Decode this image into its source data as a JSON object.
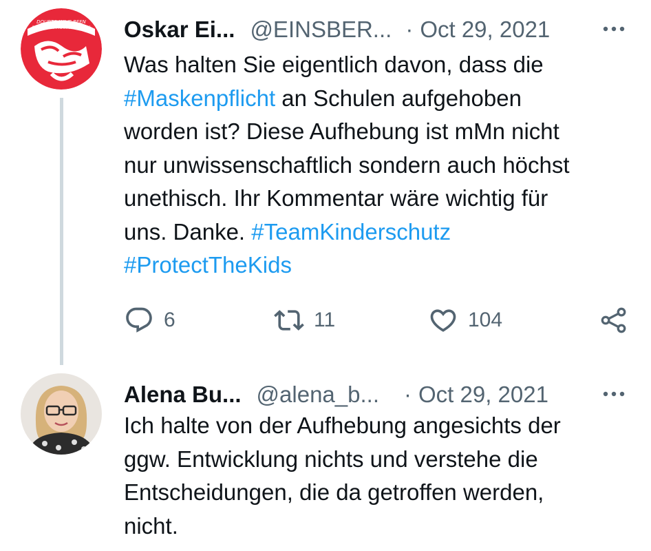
{
  "tweets": [
    {
      "name": "Oskar Ei...",
      "handle": "@EINSBER...",
      "separator": "·",
      "date": "Oct 29, 2021",
      "avatar_text": "DOUBTS HAVE BEEN PLACED BY MOVING IMAGES",
      "text_segments": [
        {
          "text": "Was halten Sie eigentlich davon, dass die",
          "type": "text",
          "break": true
        },
        {
          "text": "#Maskenpflicht",
          "type": "hashtag"
        },
        {
          "text": " an Schulen aufgehoben",
          "type": "text",
          "break": true
        },
        {
          "text": "worden ist? Diese Aufhebung ist mMn nicht",
          "type": "text",
          "break": true
        },
        {
          "text": "nur unwissenschaftlich sondern auch höchst",
          "type": "text",
          "break": true
        },
        {
          "text": "unethisch. Ihr Kommentar wäre wichtig für",
          "type": "text",
          "break": true
        },
        {
          "text": "uns. Danke. ",
          "type": "text"
        },
        {
          "text": "#TeamKinderschutz",
          "type": "hashtag",
          "break": true
        },
        {
          "text": "#ProtectTheKids",
          "type": "hashtag"
        }
      ],
      "replies": "6",
      "retweets": "11",
      "likes": "104"
    },
    {
      "name": "Alena Bu...",
      "handle": "@alena_b...",
      "separator": "·",
      "date": "Oct 29, 2021",
      "text_lines": [
        "Ich halte von der Aufhebung angesichts der",
        "ggw. Entwicklung nichts und verstehe die",
        "Entscheidungen, die da getroffen werden,",
        "nicht."
      ]
    }
  ],
  "icons": {
    "reply": "speech-bubble-icon",
    "retweet": "retweet-icon",
    "like": "heart-icon",
    "share": "share-icon",
    "more": "ellipsis-icon"
  },
  "colors": {
    "accent": "#1d9bf0",
    "secondary_text": "#536471",
    "thread_line": "#cfd9de"
  }
}
